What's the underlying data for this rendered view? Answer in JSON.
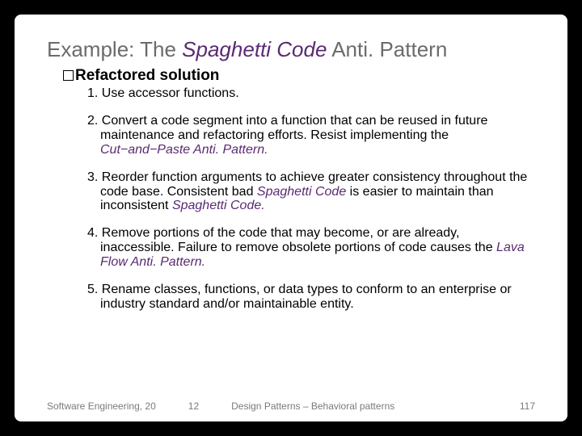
{
  "title": {
    "pre": "Example: The ",
    "em": "Spaghetti Code",
    "post": " Anti. Pattern"
  },
  "subhead": "Refactored solution",
  "steps": [
    {
      "num": "1.",
      "parts": [
        {
          "t": " Use accessor functions."
        }
      ]
    },
    {
      "num": "2.",
      "parts": [
        {
          "t": " Convert a code segment into a function that can be reused in future maintenance and refactoring efforts. Resist implementing the "
        },
        {
          "t": "Cut−and−Paste Anti. Pattern.",
          "em": true
        }
      ]
    },
    {
      "num": "3.",
      "parts": [
        {
          "t": " Reorder function arguments to achieve greater consistency throughout the code base. Consistent bad "
        },
        {
          "t": "Spaghetti Code",
          "em": true
        },
        {
          "t": " is easier to maintain than inconsistent "
        },
        {
          "t": "Spaghetti Code.",
          "em": true
        }
      ]
    },
    {
      "num": "4.",
      "parts": [
        {
          "t": " Remove portions of the code that may become, or are already, inaccessible. Failure to remove obsolete portions of code causes the "
        },
        {
          "t": "Lava Flow Anti. Pattern.",
          "em": true
        }
      ]
    },
    {
      "num": "5.",
      "parts": [
        {
          "t": " Rename classes, functions, or data types to conform to an enterprise or industry standard and/or maintainable entity."
        }
      ]
    }
  ],
  "footer": {
    "left": "Software Engineering, 20",
    "mid1": "12",
    "mid2": "Design Patterns – Behavioral patterns",
    "right": "117"
  }
}
